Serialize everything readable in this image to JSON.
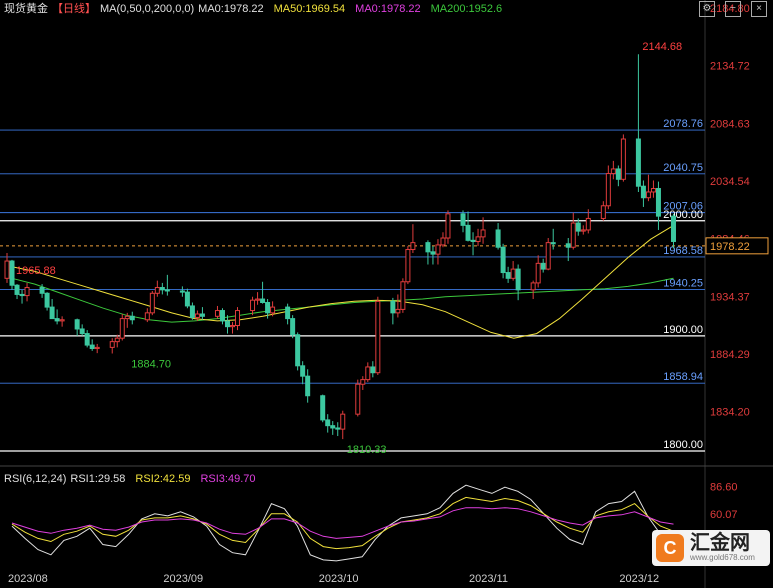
{
  "header": {
    "symbol": "现货黄金",
    "period": "【日线】",
    "ma_params": "MA(0,50,0,200,0,0)",
    "items": [
      {
        "text": "MA0:1978.22",
        "color": "#e0e0e0"
      },
      {
        "text": "MA50:1969.54",
        "color": "#f0e03c"
      },
      {
        "text": "MA0:1978.22",
        "color": "#e040e0"
      },
      {
        "text": "MA200:1952.6",
        "color": "#3cc83c"
      }
    ]
  },
  "rsi_header": {
    "label": "RSI(6,12,24)",
    "items": [
      {
        "text": "RSI1:29.58",
        "color": "#e0e0e0"
      },
      {
        "text": "RSI2:42.59",
        "color": "#f0e03c"
      },
      {
        "text": "RSI3:49.70",
        "color": "#e040e0"
      }
    ]
  },
  "colors": {
    "up": "#e03c3c",
    "down": "#3cc8a0",
    "price_axis": "#e03c3c",
    "hline_blue": "#3c78e0",
    "hline_white": "#ffffff",
    "ma50": "#f0e03c",
    "ma200": "#3cc83c"
  },
  "chart_data": [
    {
      "type": "candlestick",
      "x_range": [
        "2023-08-01",
        "2023-12-11"
      ],
      "y_range": [
        1800,
        2184.8
      ],
      "y_ticks": [
        2184.8,
        2134.72,
        2084.63,
        2034.54,
        1984.46,
        1934.37,
        1884.29,
        1834.2
      ],
      "last_price": 1978.22,
      "annotations": [
        {
          "text": "2144.68",
          "x": "2023-12-04",
          "y": 2144.68,
          "color": "#ff4040"
        },
        {
          "text": "1965.88",
          "x": "2023-08-01",
          "y": 1965.88,
          "color": "#ff4040"
        },
        {
          "text": "1884.70",
          "x": "2023-08-24",
          "y": 1884.7,
          "color": "#3cc83c"
        },
        {
          "text": "1810.33",
          "x": "2023-10-06",
          "y": 1810.33,
          "color": "#3cc83c"
        }
      ],
      "horizontal_lines": [
        {
          "label": "2078.76",
          "y": 2078.76,
          "color": "#3c78e0"
        },
        {
          "label": "2040.75",
          "y": 2040.75,
          "color": "#3c78e0"
        },
        {
          "label": "2007.06",
          "y": 2007.06,
          "color": "#3c78e0"
        },
        {
          "label": "2000.00",
          "y": 2000.0,
          "color": "#ffffff"
        },
        {
          "label": "1968.58",
          "y": 1968.58,
          "color": "#3c78e0"
        },
        {
          "label": "1940.25",
          "y": 1940.25,
          "color": "#3c78e0"
        },
        {
          "label": "1900.00",
          "y": 1900.0,
          "color": "#ffffff"
        },
        {
          "label": "1858.94",
          "y": 1858.94,
          "color": "#3c78e0"
        },
        {
          "label": "1800.00",
          "y": 1800.0,
          "color": "#ffffff"
        }
      ],
      "x_labels": [
        {
          "text": "2023/08",
          "x": "2023-08-01"
        },
        {
          "text": "2023/09",
          "x": "2023-09-01"
        },
        {
          "text": "2023/10",
          "x": "2023-10-02"
        },
        {
          "text": "2023/11",
          "x": "2023-11-01"
        },
        {
          "text": "2023/12",
          "x": "2023-12-01"
        }
      ],
      "candles": [
        {
          "x": "2023-07-31",
          "o": 1950,
          "h": 1972,
          "l": 1946,
          "c": 1965
        },
        {
          "x": "2023-08-01",
          "o": 1965,
          "h": 1966,
          "l": 1940,
          "c": 1944
        },
        {
          "x": "2023-08-02",
          "o": 1944,
          "h": 1945,
          "l": 1932,
          "c": 1936
        },
        {
          "x": "2023-08-03",
          "o": 1936,
          "h": 1940,
          "l": 1928,
          "c": 1935
        },
        {
          "x": "2023-08-04",
          "o": 1935,
          "h": 1946,
          "l": 1930,
          "c": 1942
        },
        {
          "x": "2023-08-07",
          "o": 1942,
          "h": 1945,
          "l": 1933,
          "c": 1937
        },
        {
          "x": "2023-08-08",
          "o": 1937,
          "h": 1938,
          "l": 1922,
          "c": 1925
        },
        {
          "x": "2023-08-09",
          "o": 1925,
          "h": 1932,
          "l": 1918,
          "c": 1915
        },
        {
          "x": "2023-08-10",
          "o": 1915,
          "h": 1923,
          "l": 1910,
          "c": 1913
        },
        {
          "x": "2023-08-11",
          "o": 1913,
          "h": 1917,
          "l": 1908,
          "c": 1914
        },
        {
          "x": "2023-08-14",
          "o": 1914,
          "h": 1915,
          "l": 1900,
          "c": 1906
        },
        {
          "x": "2023-08-15",
          "o": 1906,
          "h": 1910,
          "l": 1900,
          "c": 1902
        },
        {
          "x": "2023-08-16",
          "o": 1902,
          "h": 1905,
          "l": 1890,
          "c": 1892
        },
        {
          "x": "2023-08-17",
          "o": 1892,
          "h": 1897,
          "l": 1887,
          "c": 1889
        },
        {
          "x": "2023-08-18",
          "o": 1889,
          "h": 1893,
          "l": 1885,
          "c": 1890
        },
        {
          "x": "2023-08-21",
          "o": 1890,
          "h": 1898,
          "l": 1884.7,
          "c": 1895
        },
        {
          "x": "2023-08-22",
          "o": 1895,
          "h": 1901,
          "l": 1890,
          "c": 1898
        },
        {
          "x": "2023-08-23",
          "o": 1898,
          "h": 1919,
          "l": 1896,
          "c": 1915
        },
        {
          "x": "2023-08-24",
          "o": 1915,
          "h": 1920,
          "l": 1907,
          "c": 1917
        },
        {
          "x": "2023-08-25",
          "o": 1917,
          "h": 1921,
          "l": 1910,
          "c": 1914
        },
        {
          "x": "2023-08-28",
          "o": 1914,
          "h": 1924,
          "l": 1912,
          "c": 1920
        },
        {
          "x": "2023-08-29",
          "o": 1920,
          "h": 1939,
          "l": 1918,
          "c": 1937
        },
        {
          "x": "2023-08-30",
          "o": 1937,
          "h": 1948,
          "l": 1934,
          "c": 1942
        },
        {
          "x": "2023-08-31",
          "o": 1942,
          "h": 1946,
          "l": 1936,
          "c": 1940
        },
        {
          "x": "2023-09-01",
          "o": 1940,
          "h": 1953,
          "l": 1935,
          "c": 1939
        },
        {
          "x": "2023-09-04",
          "o": 1939,
          "h": 1943,
          "l": 1934,
          "c": 1938
        },
        {
          "x": "2023-09-05",
          "o": 1938,
          "h": 1941,
          "l": 1924,
          "c": 1926
        },
        {
          "x": "2023-09-06",
          "o": 1926,
          "h": 1929,
          "l": 1914,
          "c": 1916
        },
        {
          "x": "2023-09-07",
          "o": 1916,
          "h": 1922,
          "l": 1913,
          "c": 1919
        },
        {
          "x": "2023-09-08",
          "o": 1919,
          "h": 1925,
          "l": 1914,
          "c": 1917
        },
        {
          "x": "2023-09-11",
          "o": 1917,
          "h": 1926,
          "l": 1915,
          "c": 1922
        },
        {
          "x": "2023-09-12",
          "o": 1922,
          "h": 1924,
          "l": 1910,
          "c": 1913
        },
        {
          "x": "2023-09-13",
          "o": 1913,
          "h": 1918,
          "l": 1902,
          "c": 1908
        },
        {
          "x": "2023-09-14",
          "o": 1908,
          "h": 1912,
          "l": 1902,
          "c": 1909
        },
        {
          "x": "2023-09-15",
          "o": 1909,
          "h": 1925,
          "l": 1905,
          "c": 1922
        },
        {
          "x": "2023-09-18",
          "o": 1922,
          "h": 1934,
          "l": 1918,
          "c": 1931
        },
        {
          "x": "2023-09-19",
          "o": 1931,
          "h": 1938,
          "l": 1927,
          "c": 1932
        },
        {
          "x": "2023-09-20",
          "o": 1932,
          "h": 1947,
          "l": 1928,
          "c": 1929
        },
        {
          "x": "2023-09-21",
          "o": 1929,
          "h": 1932,
          "l": 1915,
          "c": 1920
        },
        {
          "x": "2023-09-22",
          "o": 1920,
          "h": 1930,
          "l": 1917,
          "c": 1925
        },
        {
          "x": "2023-09-25",
          "o": 1925,
          "h": 1928,
          "l": 1910,
          "c": 1915
        },
        {
          "x": "2023-09-26",
          "o": 1915,
          "h": 1918,
          "l": 1898,
          "c": 1901
        },
        {
          "x": "2023-09-27",
          "o": 1901,
          "h": 1903,
          "l": 1870,
          "c": 1874
        },
        {
          "x": "2023-09-28",
          "o": 1874,
          "h": 1878,
          "l": 1858,
          "c": 1865
        },
        {
          "x": "2023-09-29",
          "o": 1865,
          "h": 1871,
          "l": 1842,
          "c": 1848
        },
        {
          "x": "2023-10-02",
          "o": 1848,
          "h": 1849,
          "l": 1825,
          "c": 1827
        },
        {
          "x": "2023-10-03",
          "o": 1827,
          "h": 1832,
          "l": 1816,
          "c": 1822
        },
        {
          "x": "2023-10-04",
          "o": 1822,
          "h": 1826,
          "l": 1814,
          "c": 1820
        },
        {
          "x": "2023-10-05",
          "o": 1820,
          "h": 1825,
          "l": 1813,
          "c": 1819
        },
        {
          "x": "2023-10-06",
          "o": 1819,
          "h": 1835,
          "l": 1810.33,
          "c": 1832
        },
        {
          "x": "2023-10-09",
          "o": 1832,
          "h": 1862,
          "l": 1830,
          "c": 1858
        },
        {
          "x": "2023-10-10",
          "o": 1858,
          "h": 1865,
          "l": 1853,
          "c": 1862
        },
        {
          "x": "2023-10-11",
          "o": 1862,
          "h": 1877,
          "l": 1860,
          "c": 1873
        },
        {
          "x": "2023-10-12",
          "o": 1873,
          "h": 1878,
          "l": 1864,
          "c": 1868
        },
        {
          "x": "2023-10-13",
          "o": 1868,
          "h": 1934,
          "l": 1866,
          "c": 1930
        },
        {
          "x": "2023-10-16",
          "o": 1930,
          "h": 1933,
          "l": 1910,
          "c": 1920
        },
        {
          "x": "2023-10-17",
          "o": 1920,
          "h": 1936,
          "l": 1916,
          "c": 1923
        },
        {
          "x": "2023-10-18",
          "o": 1923,
          "h": 1950,
          "l": 1920,
          "c": 1947
        },
        {
          "x": "2023-10-19",
          "o": 1947,
          "h": 1978,
          "l": 1945,
          "c": 1975
        },
        {
          "x": "2023-10-20",
          "o": 1975,
          "h": 1997,
          "l": 1972,
          "c": 1981
        },
        {
          "x": "2023-10-23",
          "o": 1981,
          "h": 1983,
          "l": 1962,
          "c": 1973
        },
        {
          "x": "2023-10-24",
          "o": 1973,
          "h": 1978,
          "l": 1962,
          "c": 1971
        },
        {
          "x": "2023-10-25",
          "o": 1971,
          "h": 1984,
          "l": 1962,
          "c": 1979
        },
        {
          "x": "2023-10-26",
          "o": 1979,
          "h": 1990,
          "l": 1977,
          "c": 1985
        },
        {
          "x": "2023-10-27",
          "o": 1985,
          "h": 2009,
          "l": 1980,
          "c": 2006
        },
        {
          "x": "2023-10-30",
          "o": 2006,
          "h": 2009,
          "l": 1990,
          "c": 1996
        },
        {
          "x": "2023-10-31",
          "o": 1996,
          "h": 2008,
          "l": 1982,
          "c": 1983
        },
        {
          "x": "2023-11-01",
          "o": 1983,
          "h": 1990,
          "l": 1970,
          "c": 1982
        },
        {
          "x": "2023-11-02",
          "o": 1982,
          "h": 1993,
          "l": 1978,
          "c": 1986
        },
        {
          "x": "2023-11-03",
          "o": 1986,
          "h": 2003,
          "l": 1980,
          "c": 1992
        },
        {
          "x": "2023-11-06",
          "o": 1992,
          "h": 1998,
          "l": 1975,
          "c": 1977
        },
        {
          "x": "2023-11-07",
          "o": 1977,
          "h": 1980,
          "l": 1950,
          "c": 1955
        },
        {
          "x": "2023-11-08",
          "o": 1955,
          "h": 1960,
          "l": 1946,
          "c": 1950
        },
        {
          "x": "2023-11-09",
          "o": 1950,
          "h": 1965,
          "l": 1948,
          "c": 1958
        },
        {
          "x": "2023-11-10",
          "o": 1958,
          "h": 1962,
          "l": 1931,
          "c": 1940
        },
        {
          "x": "2023-11-13",
          "o": 1940,
          "h": 1948,
          "l": 1932,
          "c": 1946
        },
        {
          "x": "2023-11-14",
          "o": 1946,
          "h": 1970,
          "l": 1942,
          "c": 1963
        },
        {
          "x": "2023-11-15",
          "o": 1963,
          "h": 1967,
          "l": 1955,
          "c": 1958
        },
        {
          "x": "2023-11-16",
          "o": 1958,
          "h": 1985,
          "l": 1957,
          "c": 1981
        },
        {
          "x": "2023-11-17",
          "o": 1981,
          "h": 1993,
          "l": 1975,
          "c": 1980
        },
        {
          "x": "2023-11-20",
          "o": 1980,
          "h": 1985,
          "l": 1965,
          "c": 1977
        },
        {
          "x": "2023-11-21",
          "o": 1977,
          "h": 2007,
          "l": 1975,
          "c": 1998
        },
        {
          "x": "2023-11-22",
          "o": 1998,
          "h": 2002,
          "l": 1987,
          "c": 1991
        },
        {
          "x": "2023-11-23",
          "o": 1991,
          "h": 1996,
          "l": 1988,
          "c": 1992
        },
        {
          "x": "2023-11-24",
          "o": 1992,
          "h": 2010,
          "l": 1989,
          "c": 2002
        },
        {
          "x": "2023-11-27",
          "o": 2002,
          "h": 2017,
          "l": 2000,
          "c": 2013
        },
        {
          "x": "2023-11-28",
          "o": 2013,
          "h": 2048,
          "l": 2010,
          "c": 2041
        },
        {
          "x": "2023-11-29",
          "o": 2041,
          "h": 2052,
          "l": 2036,
          "c": 2045
        },
        {
          "x": "2023-11-30",
          "o": 2045,
          "h": 2048,
          "l": 2030,
          "c": 2036
        },
        {
          "x": "2023-12-01",
          "o": 2036,
          "h": 2075,
          "l": 2034,
          "c": 2071
        },
        {
          "x": "2023-12-04",
          "o": 2071,
          "h": 2144.68,
          "l": 2025,
          "c": 2030
        },
        {
          "x": "2023-12-05",
          "o": 2030,
          "h": 2035,
          "l": 2012,
          "c": 2020
        },
        {
          "x": "2023-12-06",
          "o": 2020,
          "h": 2040,
          "l": 2017,
          "c": 2025
        },
        {
          "x": "2023-12-07",
          "o": 2025,
          "h": 2035,
          "l": 2020,
          "c": 2028
        },
        {
          "x": "2023-12-08",
          "o": 2028,
          "h": 2034,
          "l": 1992,
          "c": 2004
        },
        {
          "x": "2023-12-11",
          "o": 2004,
          "h": 2006,
          "l": 1976,
          "c": 1982
        }
      ],
      "ma50": [
        1960,
        1956,
        1950,
        1944,
        1938,
        1932,
        1926,
        1920,
        1915,
        1913,
        1914,
        1917,
        1921,
        1925,
        1928,
        1930,
        1931,
        1930,
        1927,
        1921,
        1912,
        1903,
        1898,
        1902,
        1915,
        1932,
        1950,
        1968,
        1984,
        1996
      ],
      "ma200": [
        1950,
        1945,
        1938,
        1931,
        1924,
        1918,
        1914,
        1912,
        1913,
        1915,
        1918,
        1921,
        1923,
        1925,
        1927,
        1929,
        1930,
        1931,
        1932,
        1934,
        1935,
        1936,
        1937,
        1938,
        1939,
        1940,
        1941,
        1943,
        1946,
        1950
      ]
    },
    {
      "type": "line",
      "y_ticks": [
        86.6,
        60.07
      ],
      "y_range": [
        10,
        95
      ],
      "series": [
        {
          "name": "RSI1",
          "color": "#e0e0e0",
          "values": [
            48,
            36,
            25,
            20,
            34,
            38,
            46,
            30,
            28,
            40,
            55,
            60,
            58,
            62,
            57,
            48,
            30,
            22,
            20,
            44,
            70,
            65,
            48,
            20,
            15,
            14,
            16,
            18,
            35,
            48,
            56,
            58,
            60,
            66,
            80,
            88,
            84,
            80,
            86,
            82,
            74,
            60,
            46,
            35,
            30,
            62,
            70,
            72,
            82,
            58,
            40,
            30
          ]
        },
        {
          "name": "RSI2",
          "color": "#f0e03c",
          "values": [
            50,
            42,
            36,
            33,
            40,
            43,
            48,
            40,
            38,
            44,
            54,
            56,
            56,
            58,
            55,
            50,
            40,
            34,
            32,
            45,
            60,
            60,
            52,
            36,
            28,
            26,
            27,
            29,
            38,
            46,
            52,
            54,
            56,
            60,
            70,
            76,
            74,
            72,
            75,
            73,
            68,
            60,
            52,
            46,
            42,
            58,
            62,
            64,
            70,
            58,
            48,
            43
          ]
        },
        {
          "name": "RSI3",
          "color": "#e040e0",
          "values": [
            51,
            47,
            43,
            41,
            44,
            46,
            49,
            45,
            44,
            47,
            52,
            54,
            54,
            55,
            54,
            51,
            45,
            41,
            40,
            46,
            55,
            55,
            51,
            43,
            38,
            36,
            37,
            38,
            43,
            48,
            52,
            53,
            55,
            57,
            63,
            66,
            66,
            65,
            66,
            65,
            62,
            58,
            54,
            51,
            49,
            56,
            58,
            59,
            62,
            57,
            52,
            50
          ]
        }
      ]
    }
  ]
}
